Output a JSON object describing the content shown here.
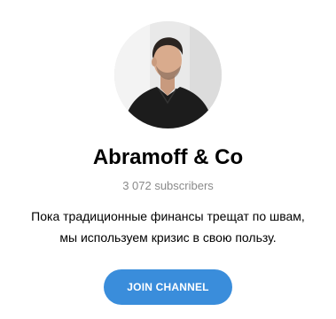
{
  "channel": {
    "avatar_icon": "channel-avatar-photo",
    "title": "Abramoff & Co",
    "subscribers": "3 072 subscribers",
    "description_lines": [
      "Пока традиционные финансы трещат по швам,",
      "мы используем кризис в свою пользу."
    ]
  },
  "actions": {
    "join_label": "JOIN CHANNEL"
  },
  "colors": {
    "accent": "#3a8ddb",
    "muted_text": "#8a8a8a",
    "text": "#000000",
    "background": "#ffffff"
  }
}
